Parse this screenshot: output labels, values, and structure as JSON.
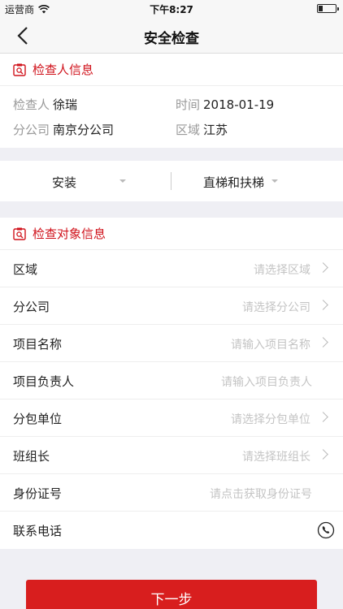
{
  "status_bar": {
    "carrier": "运营商",
    "time": "下午8:27",
    "battery_level": 0.25
  },
  "nav": {
    "title": "安全检查"
  },
  "inspector": {
    "title": "检查人信息",
    "inspector_label": "检查人",
    "inspector_value": "徐瑞",
    "time_label": "时间",
    "time_value": "2018-01-19",
    "branch_label": "分公司",
    "branch_value": "南京分公司",
    "region_label": "区域",
    "region_value": "江苏"
  },
  "filters": {
    "left": "安装",
    "right": "直梯和扶梯"
  },
  "target": {
    "title": "检查对象信息",
    "rows": [
      {
        "label": "区域",
        "placeholder": "请选择区域"
      },
      {
        "label": "分公司",
        "placeholder": "请选择分公司"
      },
      {
        "label": "项目名称",
        "placeholder": "请输入项目名称"
      },
      {
        "label": "项目负责人",
        "placeholder": "请输入项目负责人"
      },
      {
        "label": "分包单位",
        "placeholder": "请选择分包单位"
      },
      {
        "label": "班组长",
        "placeholder": "请选择班组长"
      },
      {
        "label": "身份证号",
        "placeholder": "请点击获取身份证号"
      },
      {
        "label": "联系电话",
        "placeholder": ""
      }
    ]
  },
  "footer": {
    "next_label": "下一步"
  },
  "colors": {
    "accent": "#d0121b",
    "button": "#d81e1e",
    "placeholder": "#c4c4c4"
  }
}
